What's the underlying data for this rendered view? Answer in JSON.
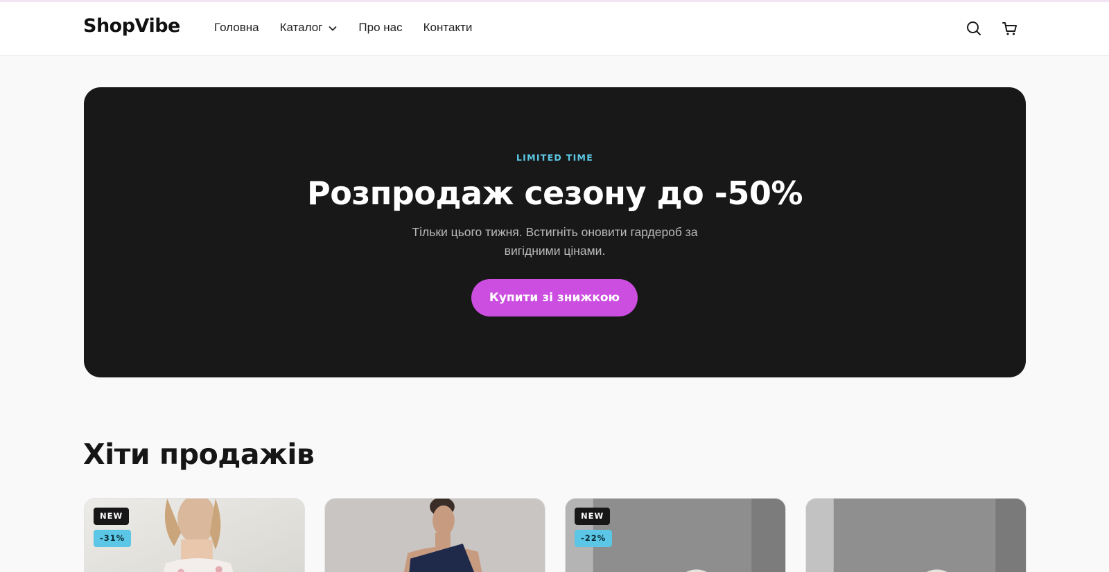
{
  "header": {
    "logo": "ShopVibe",
    "nav": [
      {
        "label": "Головна"
      },
      {
        "label": "Каталог",
        "has_dropdown": true
      },
      {
        "label": "Про нас"
      },
      {
        "label": "Контакти"
      }
    ],
    "icons": [
      "search-icon",
      "cart-icon"
    ]
  },
  "hero": {
    "eyebrow": "LIMITED TIME",
    "title": "Розпродаж сезону до -50%",
    "subtitle": "Тільки цього тижня. Встигніть оновити гардероб за вигідними цінами.",
    "cta_label": "Купити зі знижкою",
    "colors": {
      "background": "#181818",
      "accent": "#cc4ee0",
      "eyebrow": "#5cc8e6"
    }
  },
  "bestsellers": {
    "title": "Хіти продажів",
    "products": [
      {
        "badge_new": "NEW",
        "badge_discount": "-31%",
        "image": "woman-white-floral-dress"
      },
      {
        "badge_new": "",
        "badge_discount": "",
        "image": "woman-navy-one-shoulder-dress"
      },
      {
        "badge_new": "NEW",
        "badge_discount": "-22%",
        "image": "sneakers-gray-studio"
      },
      {
        "badge_new": "",
        "badge_discount": "",
        "image": "sneakers-gray-studio-alt"
      }
    ]
  }
}
